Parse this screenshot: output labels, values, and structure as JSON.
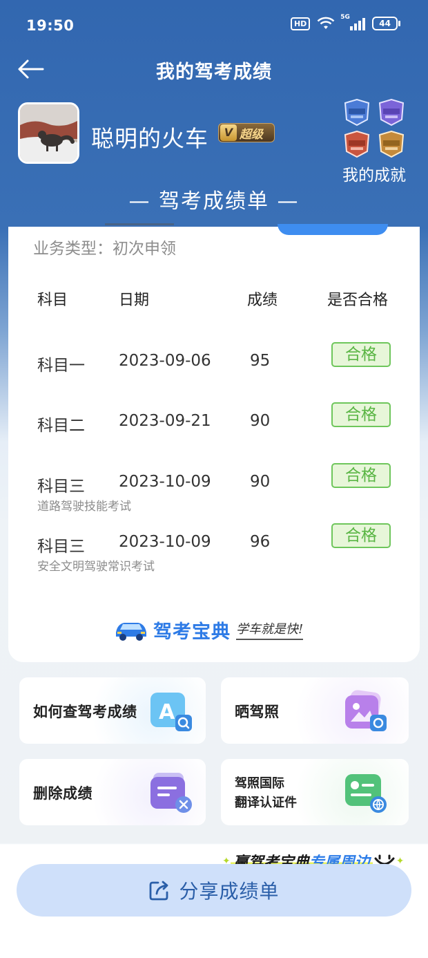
{
  "status_bar": {
    "time": "19:50",
    "hd": "HD",
    "network": "5G",
    "battery": "44"
  },
  "nav": {
    "title": "我的驾考成绩"
  },
  "profile": {
    "username": "聪明的火车",
    "vip_label": "超级",
    "achievements_label": "我的成就"
  },
  "report": {
    "title": "— 驾考成绩单 —",
    "business_type": "业务类型：初次申领",
    "headers": {
      "subject": "科目",
      "date": "日期",
      "score": "成绩",
      "passed": "是否合格"
    },
    "rows": [
      {
        "subject": "科目一",
        "date": "2023-09-06",
        "score": "95",
        "result": "合格",
        "note": ""
      },
      {
        "subject": "科目二",
        "date": "2023-09-21",
        "score": "90",
        "result": "合格",
        "note": ""
      },
      {
        "subject": "科目三",
        "date": "2023-10-09",
        "score": "90",
        "result": "合格",
        "note": "道路驾驶技能考试"
      },
      {
        "subject": "科目三",
        "date": "2023-10-09",
        "score": "96",
        "result": "合格",
        "note": "安全文明驾驶常识考试"
      }
    ],
    "brand_name": "驾考宝典",
    "brand_slogan": "学车就是快!"
  },
  "tiles": {
    "query": "如何查驾考成绩",
    "show_license": "晒驾照",
    "delete": "删除成绩",
    "intl_line1": "驾照国际",
    "intl_line2": "翻译认证件"
  },
  "promo": {
    "prefix": "赢驾考宝典",
    "highlight": "专属周边"
  },
  "share": {
    "label": "分享成绩单"
  },
  "colors": {
    "header_blue": "#3267b0",
    "pass_green": "#59b544",
    "brand_blue": "#2e7be6"
  }
}
